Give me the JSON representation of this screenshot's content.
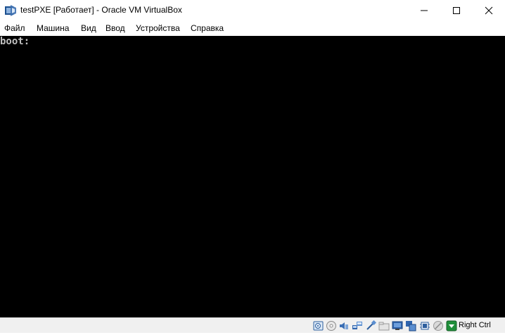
{
  "window": {
    "title": "testPXE [Работает] - Oracle VM VirtualBox",
    "icon": "virtualbox-icon",
    "controls": [
      "minimize-icon",
      "maximize-icon",
      "close-icon"
    ]
  },
  "menu": {
    "items": [
      "Файл",
      "Машина",
      "Вид",
      "Ввод",
      "Устройства",
      "Справка"
    ]
  },
  "console": {
    "lines": [
      "boot:"
    ],
    "background": "#000000",
    "text_color": "#c0c0c0"
  },
  "statusbar": {
    "icons": [
      "hard-disk-icon",
      "optical-drive-icon",
      "audio-icon",
      "network-icon",
      "usb-icon",
      "shared-folders-icon",
      "display-icon",
      "video-capture-icon",
      "cpu-icon",
      "mouse-integration-icon",
      "host-key-arrow-icon"
    ],
    "host_key": "Right Ctrl"
  }
}
